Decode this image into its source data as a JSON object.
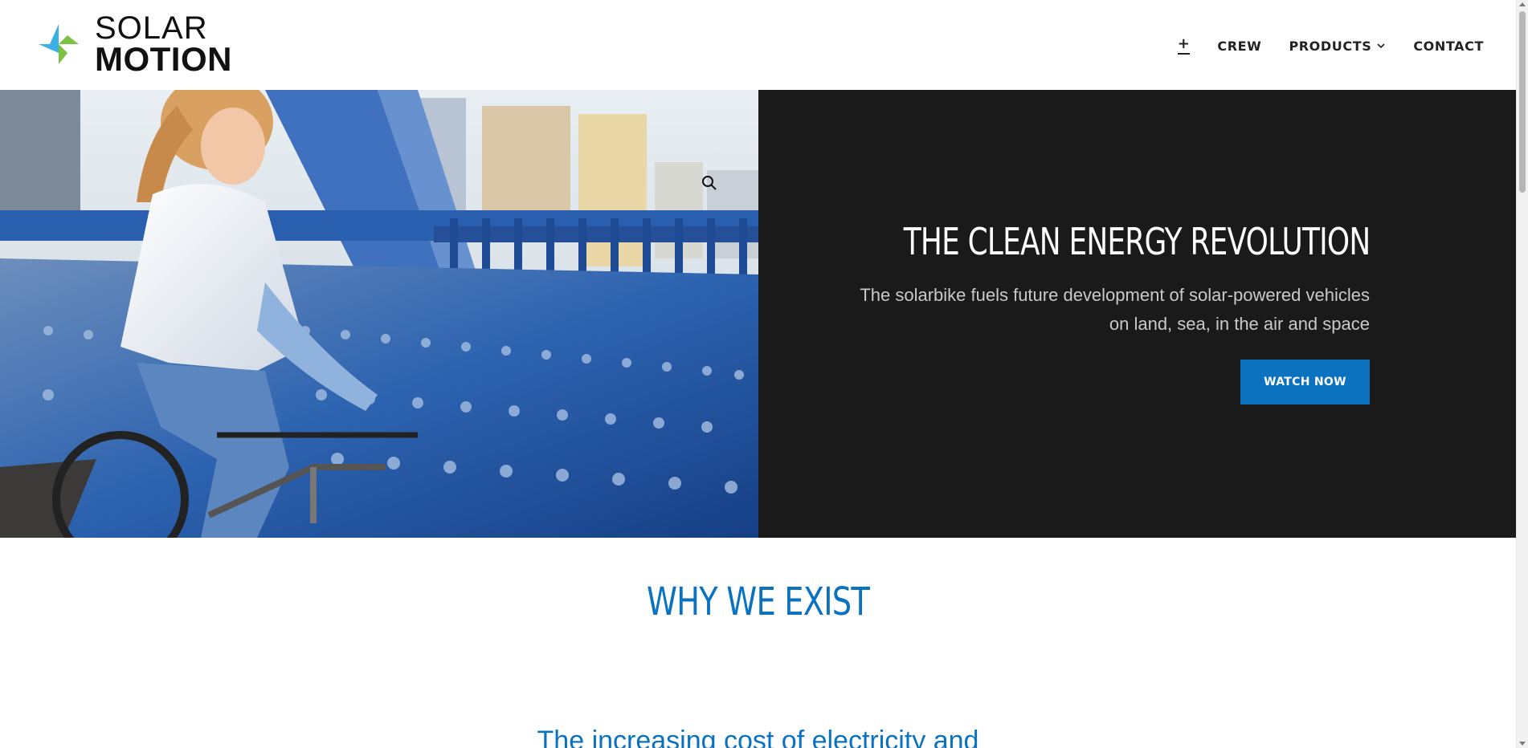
{
  "brand": {
    "line1": "SOLAR",
    "line2": "MOTION",
    "colors": {
      "blue": "#3bb0e6",
      "green": "#7cc242",
      "text": "#111111"
    }
  },
  "nav": {
    "items": [
      {
        "label": "+",
        "active": true
      },
      {
        "label": "CREW"
      },
      {
        "label": "PRODUCTS",
        "has_dropdown": true
      },
      {
        "label": "CONTACT"
      }
    ]
  },
  "hero": {
    "image_alt": "woman riding a bicycle across a blue steel bridge",
    "title": "THE CLEAN ENERGY REVOLUTION",
    "subtitle": "The solarbike fuels future development of solar-powered vehicles on land, sea, in the air and space",
    "cta_label": "WATCH NOW",
    "zoom_icon": "search-icon"
  },
  "why": {
    "title": "WHY WE EXIST",
    "intro_partial": "The increasing cost of electricity and"
  },
  "theme": {
    "accent": "#0b72c0",
    "hero_bg": "#1a1a1a",
    "subtitle_color": "#c9c9c9"
  }
}
